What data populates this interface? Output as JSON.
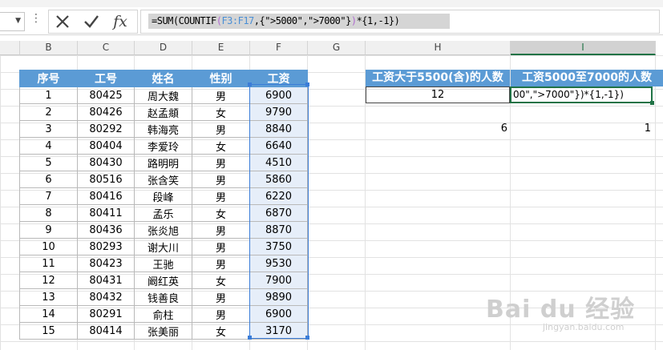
{
  "formula_bar": {
    "name_box": "",
    "cancel_icon": "close-icon",
    "enter_icon": "check-icon",
    "fx_label": "fx",
    "formula_parts": {
      "p1": "=SUM(COUNTIF",
      "p2": "(",
      "p3": "F3:F17",
      "p4": ",{\">5000\",\">7000\"}",
      "p5": ")",
      "p6": "*{1,-1})"
    }
  },
  "columns": [
    "B",
    "C",
    "D",
    "E",
    "F",
    "G",
    "H",
    "I"
  ],
  "table": {
    "headers": [
      "序号",
      "工号",
      "姓名",
      "性别",
      "工资"
    ],
    "rows": [
      [
        "1",
        "80425",
        "周大魏",
        "男",
        "6900"
      ],
      [
        "2",
        "80426",
        "赵孟頫",
        "女",
        "9790"
      ],
      [
        "3",
        "80292",
        "韩海亮",
        "男",
        "8840"
      ],
      [
        "4",
        "80404",
        "李爱玲",
        "女",
        "6640"
      ],
      [
        "5",
        "80430",
        "路明明",
        "男",
        "4510"
      ],
      [
        "6",
        "80516",
        "张含笑",
        "男",
        "5860"
      ],
      [
        "7",
        "80416",
        "段峰",
        "男",
        "6220"
      ],
      [
        "8",
        "80411",
        "孟乐",
        "女",
        "6870"
      ],
      [
        "9",
        "80436",
        "张炎旭",
        "男",
        "8870"
      ],
      [
        "10",
        "80293",
        "谢大川",
        "男",
        "3750"
      ],
      [
        "11",
        "80423",
        "王驰",
        "男",
        "9530"
      ],
      [
        "12",
        "80431",
        "阚红英",
        "女",
        "7900"
      ],
      [
        "13",
        "80432",
        "钱善良",
        "男",
        "9890"
      ],
      [
        "14",
        "80291",
        "俞柱",
        "男",
        "6900"
      ],
      [
        "15",
        "80414",
        "张美丽",
        "女",
        "3170"
      ]
    ]
  },
  "summary": {
    "h_header": "工资大于5500(含)的人数",
    "i_header": "工资5000至7000的人数",
    "h_value": "12",
    "i_editing": "00\",\">7000\"})*{1,-1})",
    "h_extra": "6",
    "i_extra": "1"
  },
  "watermark": {
    "logo": "Bai du 经验",
    "url": "jingyan.baidu.com"
  }
}
